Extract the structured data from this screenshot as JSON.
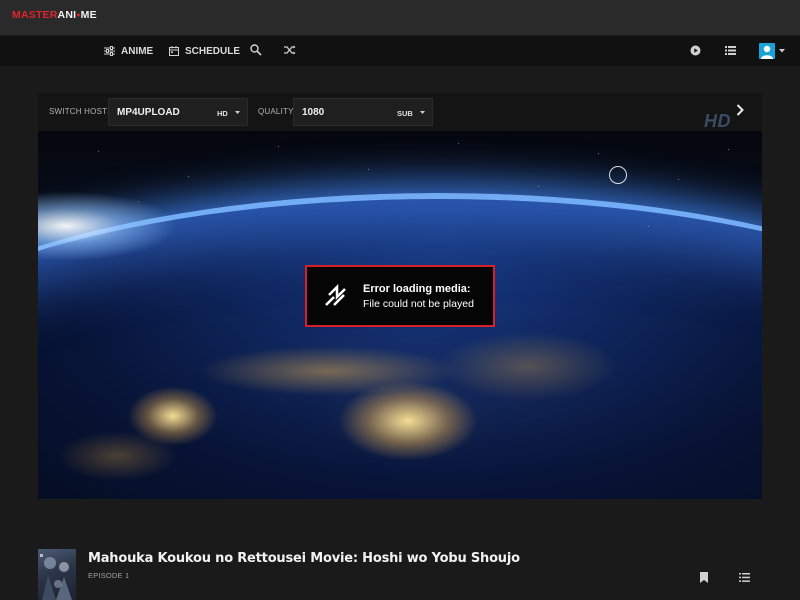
{
  "brand": {
    "logo_part1": "MASTER",
    "logo_part2": "ANI",
    "logo_dot": "●",
    "logo_part3": "ME"
  },
  "nav": {
    "anime_label": "ANIME",
    "schedule_label": "SCHEDULE",
    "icons": [
      "sliders-icon",
      "calendar-icon",
      "search-icon",
      "shuffle-icon",
      "play-circle-icon",
      "list-icon",
      "avatar"
    ]
  },
  "player": {
    "switch_hosts_label": "SWITCH HOSTS",
    "host_value": "MP4UPLOAD",
    "host_tag": "HD",
    "quality_label": "QUALITY",
    "quality_value": "1080",
    "quality_tag": "SUB",
    "watermark": "HD",
    "error_title": "Error loading media:",
    "error_message": "File could not be played"
  },
  "anime": {
    "title": "Mahouka Koukou no Rettousei Movie: Hoshi wo Yobu Shoujo",
    "episode": "EPISODE 1"
  },
  "colors": {
    "brand_red": "#e0242c",
    "error_border": "#d4202a",
    "avatar_blue": "#1aa3d6",
    "navbar_bg": "#111111",
    "page_bg": "#1a1a1a"
  }
}
